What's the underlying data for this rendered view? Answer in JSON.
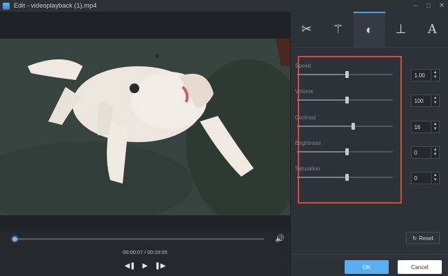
{
  "window": {
    "title": "Edit - videoplayback (1).mp4",
    "controls": [
      "–",
      "□",
      "✕"
    ]
  },
  "player": {
    "time": "00:00:07 / 00:10:05",
    "progress_fraction": 0.012
  },
  "tabs": [
    {
      "name": "cut",
      "icon": "scissors-icon",
      "glyph": "✂",
      "active": false
    },
    {
      "name": "effects",
      "icon": "magic-wand-icon",
      "glyph": "⚚",
      "active": false
    },
    {
      "name": "adjust",
      "icon": "brightness-icon",
      "glyph": "◐",
      "active": true
    },
    {
      "name": "watermark",
      "icon": "stamp-icon",
      "glyph": "⊥",
      "active": false
    },
    {
      "name": "text",
      "icon": "text-icon",
      "glyph": "A",
      "active": false
    }
  ],
  "adjustments": [
    {
      "label": "Speed",
      "value": "1.00",
      "fraction": 0.52
    },
    {
      "label": "Volume",
      "value": "100",
      "fraction": 0.52
    },
    {
      "label": "Contrast",
      "value": "16",
      "fraction": 0.58
    },
    {
      "label": "Brightness",
      "value": "0",
      "fraction": 0.52
    },
    {
      "label": "Saturation",
      "value": "0",
      "fraction": 0.52
    }
  ],
  "buttons": {
    "reset": "Reset",
    "ok": "OK",
    "cancel": "Cancel"
  },
  "colors": {
    "accent": "#5aaef0",
    "highlight_border": "#d9473e"
  }
}
